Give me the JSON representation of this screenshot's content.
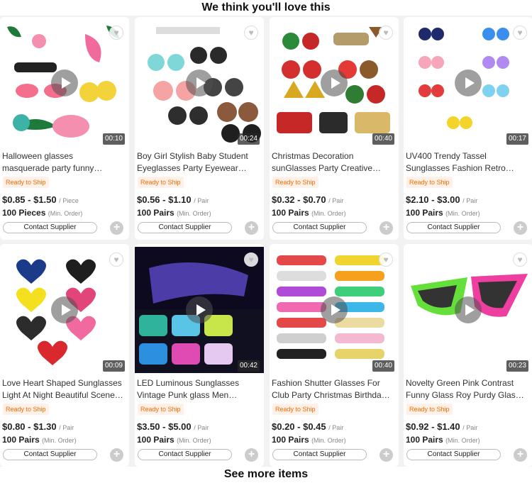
{
  "header": {
    "title": "We think you'll love this"
  },
  "footer": {
    "see_more": "See more items"
  },
  "products": [
    {
      "title_line1": "Halloween glasses",
      "title_line2": "masquerade party funny…",
      "badge": "Ready to Ship",
      "price": "$0.85 - $1.50",
      "unit": "/ Piece",
      "moq": "100 Pieces",
      "moq_note": "(Min. Order)",
      "duration": "00:10",
      "contact": "Contact Supplier",
      "theme": "flamingo"
    },
    {
      "title_line1": "Boy Girl Stylish Baby Student",
      "title_line2": "Eyeglasses Party Eyewear…",
      "badge": "Ready to Ship",
      "price": "$0.56 - $1.10",
      "unit": "/ Pair",
      "moq": "100 Pairs",
      "moq_note": "(Min. Order)",
      "duration": "00:24",
      "contact": "Contact Supplier",
      "theme": "kids"
    },
    {
      "title_line1": "Christmas Decoration",
      "title_line2": "sunGlasses Party Creative…",
      "badge": "Ready to Ship",
      "price": "$0.32 - $0.70",
      "unit": "/ Pair",
      "moq": "100 Pairs",
      "moq_note": "(Min. Order)",
      "duration": "00:40",
      "contact": "Contact Supplier",
      "theme": "christmas"
    },
    {
      "title_line1": "UV400 Trendy Tassel",
      "title_line2": "Sunglasses Fashion Retro…",
      "badge": "Ready to Ship",
      "price": "$2.10 - $3.00",
      "unit": "/ Pair",
      "moq": "100 Pairs",
      "moq_note": "(Min. Order)",
      "duration": "00:17",
      "contact": "Contact Supplier",
      "theme": "tassel"
    },
    {
      "title_line1": "Love Heart Shaped Sunglasses",
      "title_line2": "Light At Night Beautiful Scene…",
      "badge": "Ready to Ship",
      "price": "$0.80 - $1.30",
      "unit": "/ Pair",
      "moq": "100 Pairs",
      "moq_note": "(Min. Order)",
      "duration": "00:09",
      "contact": "Contact Supplier",
      "theme": "heart"
    },
    {
      "title_line1": "LED Luminous Sunglasses",
      "title_line2": "Vintage Punk glass Men…",
      "badge": "Ready to Ship",
      "price": "$3.50 - $5.00",
      "unit": "/ Pair",
      "moq": "100 Pairs",
      "moq_note": "(Min. Order)",
      "duration": "00:42",
      "contact": "Contact Supplier",
      "theme": "led"
    },
    {
      "title_line1": "Fashion Shutter Glasses For",
      "title_line2": "Club Party Christmas Birthday…",
      "badge": "Ready to Ship",
      "price": "$0.20 - $0.45",
      "unit": "/ Pair",
      "moq": "100 Pairs",
      "moq_note": "(Min. Order)",
      "duration": "00:40",
      "contact": "Contact Supplier",
      "theme": "shutter"
    },
    {
      "title_line1": "Novelty Green Pink Contrast",
      "title_line2": "Funny Glass Roy Purdy Glass…",
      "badge": "Ready to Ship",
      "price": "$0.92 - $1.40",
      "unit": "/ Pair",
      "moq": "100 Pairs",
      "moq_note": "(Min. Order)",
      "duration": "00:23",
      "contact": "Contact Supplier",
      "theme": "triangle"
    }
  ]
}
